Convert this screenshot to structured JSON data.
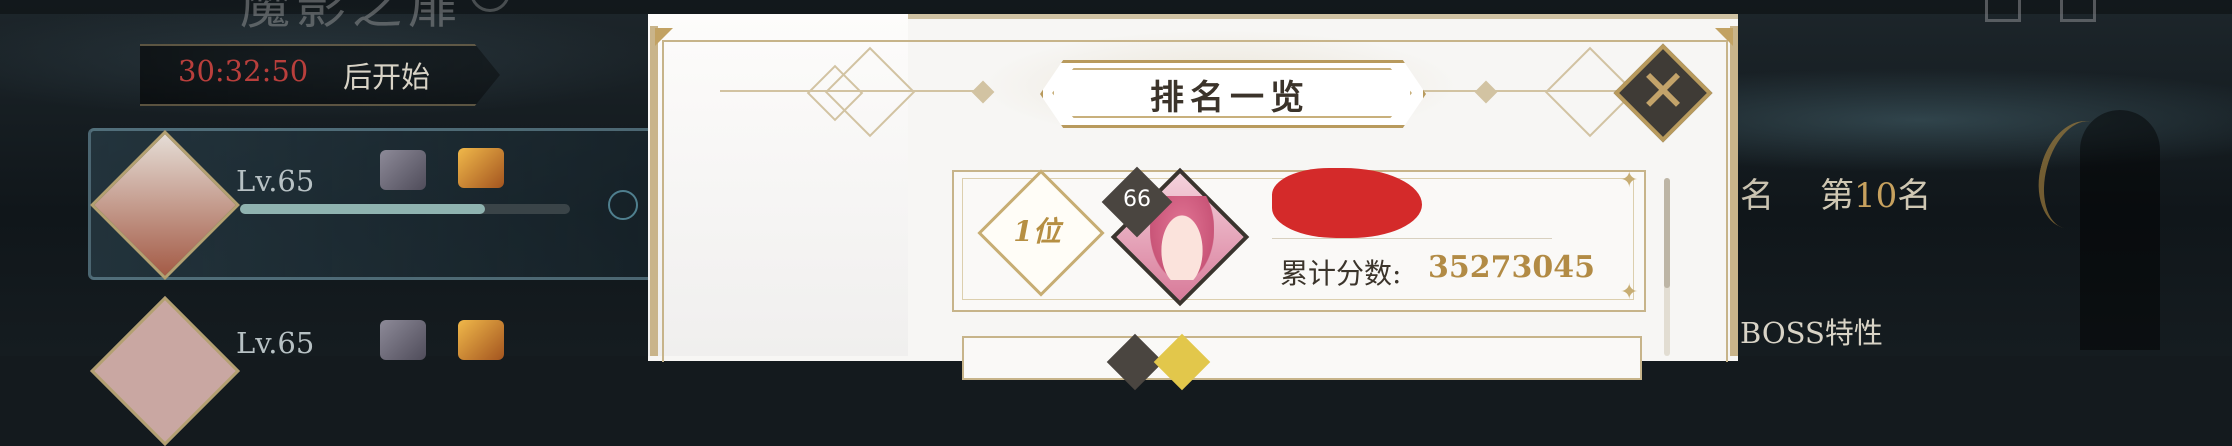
{
  "background": {
    "event_title": "魔影之扉",
    "countdown": {
      "time": "30:32:50",
      "label": "后开始"
    },
    "players": [
      {
        "level": "Lv.65"
      },
      {
        "level": "Lv.65"
      }
    ],
    "right_panel": {
      "rank_prefix": "名",
      "rank_label_prefix": "第",
      "rank_number": "10",
      "rank_label_suffix": "名",
      "boss_traits": "BOSS特性"
    }
  },
  "modal": {
    "title": "排名一览",
    "close_icon": "close-icon",
    "entries": [
      {
        "rank_label": "1位",
        "level": "66",
        "score_label": "累计分数:",
        "score": "35273045"
      }
    ]
  },
  "colors": {
    "accent_gold": "#b28b45",
    "countdown_red": "#b93f3c",
    "redaction_red": "#d42a2a",
    "modal_bg": "#f7f6f4"
  }
}
